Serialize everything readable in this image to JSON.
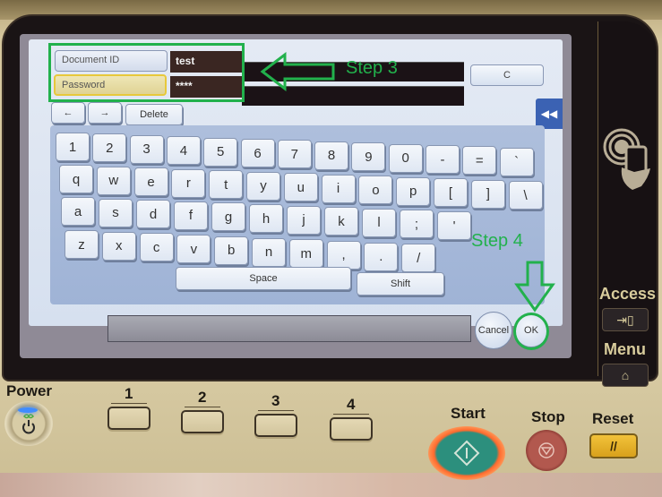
{
  "screen": {
    "fields": [
      {
        "label": "Document ID",
        "value": "test",
        "active": false
      },
      {
        "label": "Password",
        "value": "****",
        "active": true
      }
    ],
    "clear_button": "C",
    "collapse_tab": "◀◀",
    "edit_keys": {
      "left": "←",
      "right": "→",
      "delete": "Delete"
    },
    "keyboard": {
      "row1": [
        "1",
        "2",
        "3",
        "4",
        "5",
        "6",
        "7",
        "8",
        "9",
        "0",
        "-",
        "=",
        "`"
      ],
      "row2": [
        "q",
        "w",
        "e",
        "r",
        "t",
        "y",
        "u",
        "i",
        "o",
        "p",
        "[",
        "]",
        "\\"
      ],
      "row3": [
        "a",
        "s",
        "d",
        "f",
        "g",
        "h",
        "j",
        "k",
        "l",
        ";",
        "'"
      ],
      "row4": [
        "z",
        "x",
        "c",
        "v",
        "b",
        "n",
        "m",
        ",",
        ".",
        "/"
      ],
      "space": "Space",
      "shift": "Shift"
    },
    "cancel_button": "Cancel",
    "ok_button": "OK"
  },
  "annotations": {
    "step3": "Step 3",
    "step4": "Step 4",
    "color": "#22b14c"
  },
  "side_panel": {
    "access_label": "Access",
    "menu_label": "Menu"
  },
  "hardware": {
    "power_label": "Power",
    "register_keys": [
      "1",
      "2",
      "3",
      "4"
    ],
    "start_label": "Start",
    "stop_label": "Stop",
    "reset_label": "Reset",
    "reset_glyph": "//"
  }
}
